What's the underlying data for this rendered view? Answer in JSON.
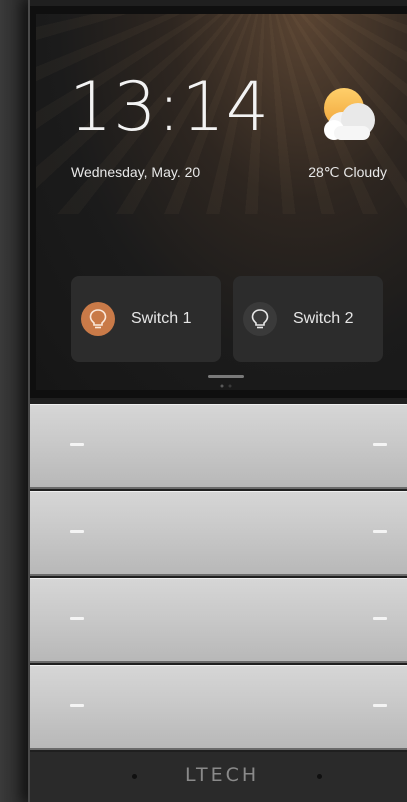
{
  "clock": {
    "time": "13:14",
    "date": "Wednesday, May. 20"
  },
  "weather": {
    "text": "28℃  Cloudy",
    "icon": "partly-cloudy-icon"
  },
  "switches": [
    {
      "label": "Switch 1",
      "state": "on",
      "icon": "bulb-icon",
      "color": "#c97a48"
    },
    {
      "label": "Switch 2",
      "state": "off",
      "icon": "bulb-icon",
      "color": "#3a3a3a"
    }
  ],
  "keys": [
    {
      "name": "key-1"
    },
    {
      "name": "key-2"
    },
    {
      "name": "key-3"
    },
    {
      "name": "key-4"
    }
  ],
  "brand": {
    "logo": "LTECH"
  }
}
